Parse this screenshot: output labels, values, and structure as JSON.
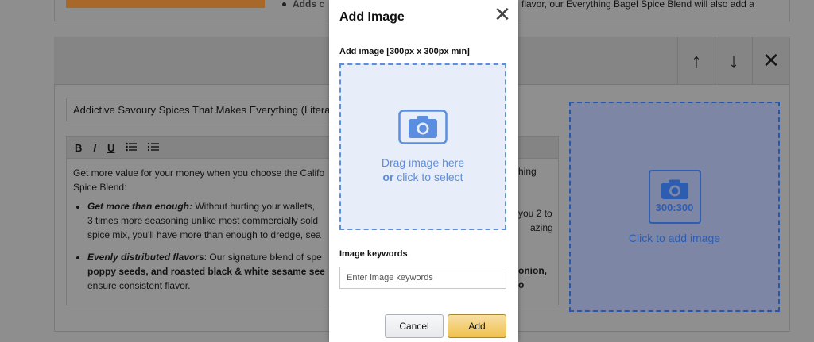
{
  "background": {
    "top_bullet": "Adds c",
    "top_bullet_right": "flavor, our Everything Bagel Spice Blend will also add a",
    "headline_value": "Addictive Savoury Spices That Makes Everything (Literally",
    "toolbar": {
      "bold": "B",
      "italic": "I",
      "underline": "U"
    },
    "body": {
      "intro": "Get more value for your money when you choose the Califo",
      "intro_right": "hing",
      "intro_line2": "Spice Blend:",
      "bullet1_title": "Get more than enough:",
      "bullet1_text": " Without hurting your wallets,",
      "bullet1_right": "you 2 to",
      "bullet1_line2": "3 times more seasoning unlike most commercially sold",
      "bullet1_line2_right": "azing",
      "bullet1_line3": "spice mix, you'll have more than enough to dredge, sea",
      "bullet2_title": "Evenly distributed flavors",
      "bullet2_text": ": Our signature blend of spe",
      "bullet2_right": "onion,",
      "bullet2_line2": "poppy seeds, and roasted black & white sesame see",
      "bullet2_line2_right": "o",
      "bullet2_line3": "ensure consistent flavor."
    },
    "controls": {
      "up": "↑",
      "down": "↓",
      "remove": "✕"
    },
    "placeholder": {
      "ratio": "300:300",
      "label": "Click to add image"
    }
  },
  "modal": {
    "title": "Add Image",
    "close": "✕",
    "image_label": "Add image [300px x 300px min]",
    "drop_line1": "Drag image here",
    "drop_or": "or",
    "drop_line2": " click to select",
    "keywords_label": "Image keywords",
    "keywords_placeholder": "Enter image keywords",
    "keywords_value": "",
    "cancel_label": "Cancel",
    "add_label": "Add"
  },
  "colors": {
    "accent_blue": "#5b8ee0",
    "add_button": "#f0c14b",
    "overlay": "#8e8e8e"
  }
}
